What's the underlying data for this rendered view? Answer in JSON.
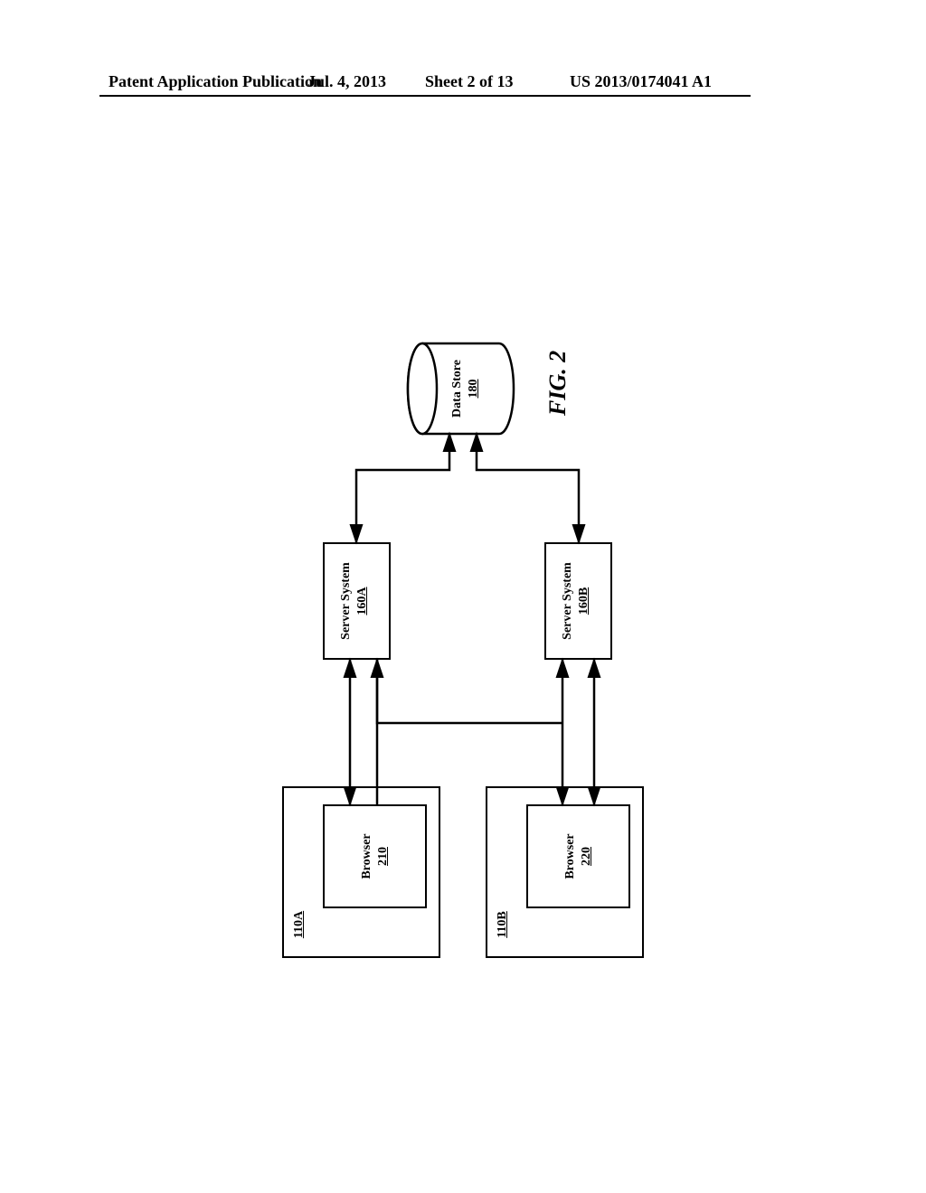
{
  "header": {
    "left": "Patent Application Publication",
    "date": "Jul. 4, 2013",
    "sheet": "Sheet 2 of 13",
    "pubno": "US 2013/0174041 A1"
  },
  "figure": {
    "caption": "FIG. 2",
    "clientA": {
      "outer_ref": "110A",
      "inner_name": "Browser",
      "inner_ref": "210"
    },
    "clientB": {
      "outer_ref": "110B",
      "inner_name": "Browser",
      "inner_ref": "220"
    },
    "serverA": {
      "name": "Server System",
      "ref": "160A"
    },
    "serverB": {
      "name": "Server System",
      "ref": "160B"
    },
    "store": {
      "name": "Data Store",
      "ref": "180"
    }
  }
}
